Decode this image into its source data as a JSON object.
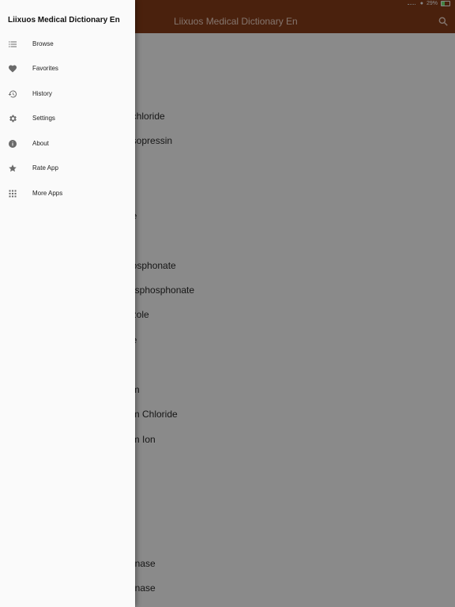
{
  "status_bar": {
    "battery": "29%"
  },
  "app_bar": {
    "title": "Liixuos Medical Dictionary En"
  },
  "drawer": {
    "title": "Liixuos Medical Dictionary En",
    "items": [
      {
        "label": "Browse",
        "icon": "list-icon"
      },
      {
        "label": "Favorites",
        "icon": "heart-icon"
      },
      {
        "label": "History",
        "icon": "history-icon"
      },
      {
        "label": "Settings",
        "icon": "gear-icon"
      },
      {
        "label": "About",
        "icon": "info-icon"
      },
      {
        "label": "Rate App",
        "icon": "star-icon"
      },
      {
        "label": "More Apps",
        "icon": "grid-icon"
      }
    ]
  },
  "list": {
    "items": [
      "ochloride",
      "asopressin",
      "ne",
      "hosphonate",
      "Bisphosphonate",
      "azole",
      "ne",
      "e",
      "um",
      "um Chloride",
      "um Ion",
      "e",
      "Kinase",
      "Kinase"
    ]
  },
  "colors": {
    "app_bar": "#8a3d19",
    "drawer_bg": "#fafafa",
    "icon": "#6a6a6a"
  }
}
